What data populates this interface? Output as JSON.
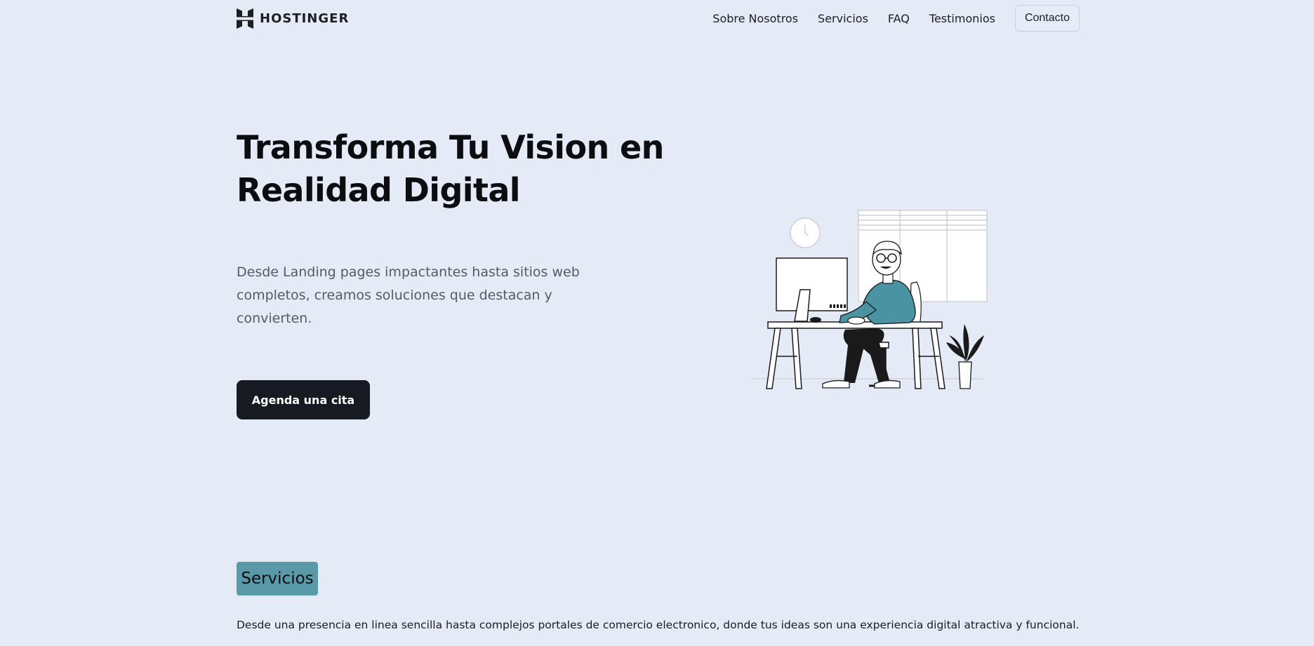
{
  "header": {
    "brand": "HOSTINGER",
    "nav": [
      "Sobre Nosotros",
      "Servicios",
      "FAQ",
      "Testimonios"
    ],
    "cta": "Contacto"
  },
  "hero": {
    "title_line1": "Transforma Tu Vision en",
    "title_line2": "Realidad Digital",
    "subtitle": "Desde Landing pages impactantes hasta sitios web completos, creamos soluciones que destacan y convierten.",
    "button": "Agenda una cita",
    "illustration": "person-working-at-desk"
  },
  "services": {
    "tag": "Servicios",
    "description": "Desde una presencia en linea sencilla hasta complejos portales de comercio electronico, donde tus ideas son una experiencia digital atractiva y funcional."
  },
  "colors": {
    "background": "#e4eaf6",
    "primary_button": "#181a22",
    "accent": "#5a9aa8"
  }
}
